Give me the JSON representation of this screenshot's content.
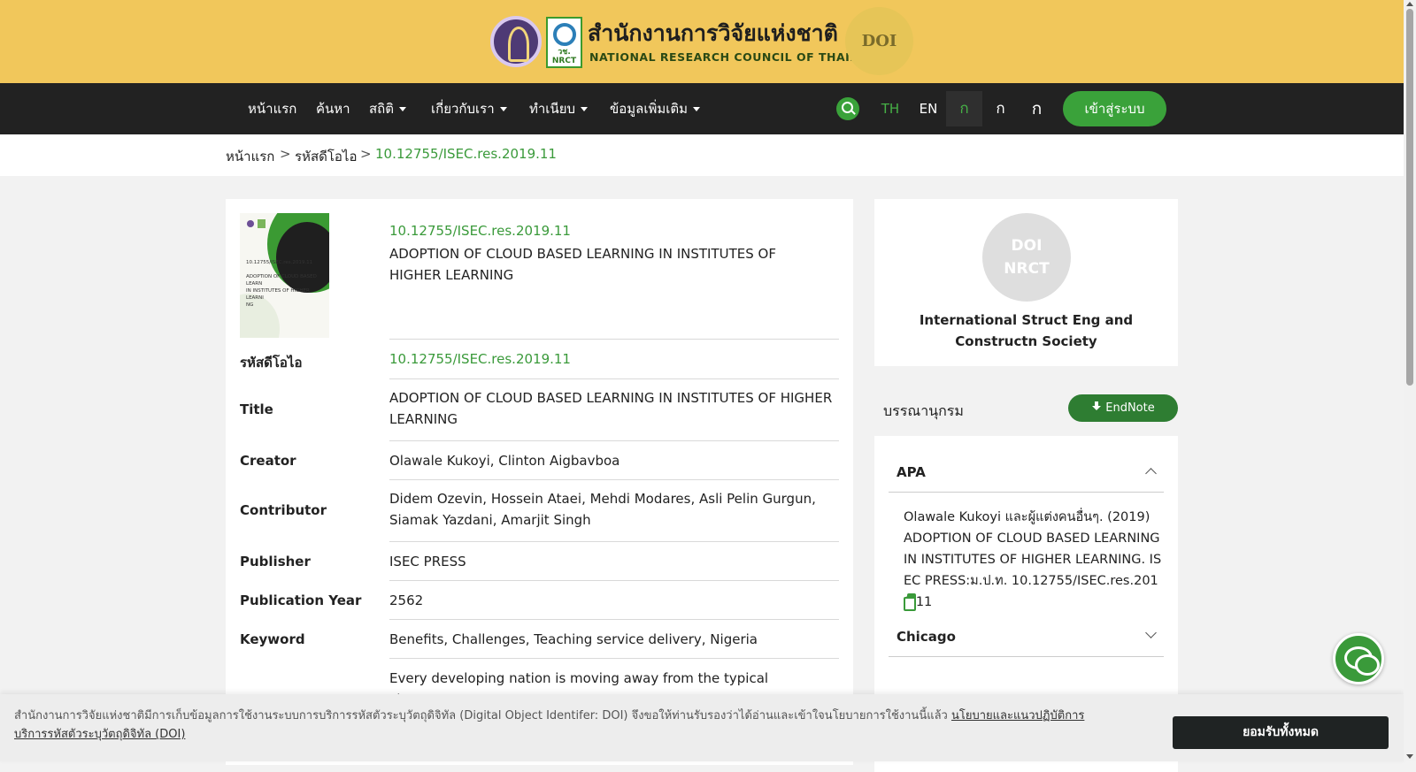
{
  "header": {
    "title_th": "สำนักงานการวิจัยแห่งชาติ",
    "title_en": "NATIONAL RESEARCH COUNCIL OF THAILAND",
    "nrct_logo_text": "วช.\nNRCT",
    "doi_badge_text": "DOI"
  },
  "nav": {
    "items": [
      {
        "label": "หน้าแรก",
        "has_dropdown": false
      },
      {
        "label": "ค้นหา",
        "has_dropdown": false
      },
      {
        "label": "สถิติ",
        "has_dropdown": true
      },
      {
        "label": "เกี่ยวกับเรา",
        "has_dropdown": true
      },
      {
        "label": "ทำเนียบ",
        "has_dropdown": true
      },
      {
        "label": "ข้อมูลเพิ่มเติม",
        "has_dropdown": true
      }
    ],
    "languages": [
      "TH",
      "EN"
    ],
    "active_language": "TH",
    "font_sizes": [
      "ก",
      "ก",
      "ก"
    ],
    "login_label": "เข้าสู่ระบบ"
  },
  "breadcrumb": {
    "items": [
      "หน้าแรก",
      "รหัสดีโอไอ",
      "10.12755/ISEC.res.2019.11"
    ],
    "separator": ">"
  },
  "record": {
    "cover_text": "10.12755/ISEC.res.2019.11\nADOPTION OF CLOUD BASED LEARN\nIN INSTITUTES OF HIGHER LEARNI\nNG",
    "header_doi": "10.12755/ISEC.res.2019.11",
    "header_title": "ADOPTION OF CLOUD BASED LEARNING IN INSTITUTES OF HIGHER LEARNING",
    "fields": [
      {
        "label": "รหัสดีโอไอ",
        "value": "10.12755/ISEC.res.2019.11"
      },
      {
        "label": "Title",
        "value": "ADOPTION OF CLOUD BASED LEARNING IN INSTITUTES OF HIGHER LEARNING"
      },
      {
        "label": "Creator",
        "value": "Olawale Kukoyi, Clinton Aigbavboa"
      },
      {
        "label": "Contributor",
        "value": "Didem Ozevin, Hossein Ataei, Mehdi Modares, Asli Pelin Gurgun, Siamak Yazdani, Amarjit Singh"
      },
      {
        "label": "Publisher",
        "value": "ISEC PRESS"
      },
      {
        "label": "Publication Year",
        "value": "2562"
      },
      {
        "label": "Keyword",
        "value": "Benefits, Challenges, Teaching service delivery, Nigeria"
      },
      {
        "label": "",
        "value": "Every developing nation is moving away from the typical classroom"
      }
    ]
  },
  "publisher_card": {
    "avatar_text": "DOI\nNRCT",
    "name": "International Struct Eng and Constructn Society"
  },
  "bibliography": {
    "label": "บรรณานุกรม",
    "endnote_label": "EndNote",
    "styles": [
      {
        "name": "APA",
        "expanded": true,
        "text": "Olawale Kukoyi และผู้แต่งคนอื่นๆ. (2019) ADOPTION OF CLOUD BASED LEARNING IN INSTITUTES OF HIGHER LEARNING. ISEC PRESS:ม.ป.ท. 10.12755/ISEC.res.2019.11"
      },
      {
        "name": "Chicago",
        "expanded": false
      }
    ]
  },
  "cookie": {
    "text": "สำนักงานการวิจัยแห่งชาติมีการเก็บข้อมูลการใช้งานระบบการบริการรหัสตัวระบุวัตถุดิจิทัล (Digital Object Identifer: DOI) จึงขอให้ท่านรับรองว่าได้อ่านและเข้าใจนโยบายการใช้งานนี้แล้ว",
    "link_text": "นโยบายและแนวปฏิบัติการบริการรหัสตัวระบุวัตถุดิจิทัล (DOI)",
    "accept_label": "ยอมรับทั้งหมด"
  },
  "colors": {
    "header_bg": "#f1c75b",
    "nav_bg": "#222222",
    "accent_green": "#3a9a3a",
    "endnote_bg": "#2e7d32"
  }
}
